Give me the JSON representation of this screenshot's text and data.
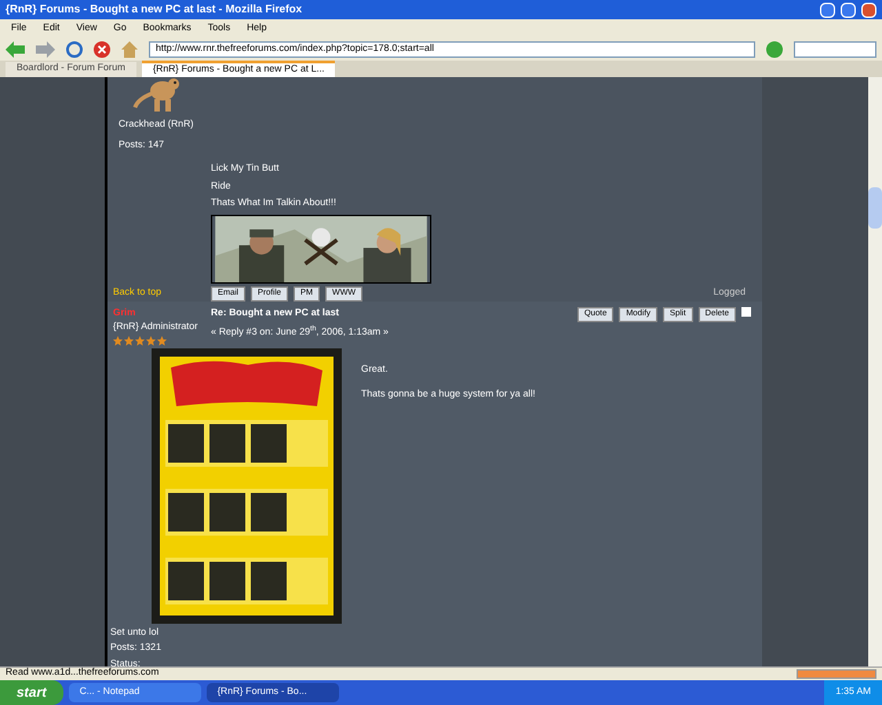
{
  "window": {
    "title": "{RnR} Forums - Bought a new PC at last - Mozilla Firefox"
  },
  "menu": [
    "File",
    "Edit",
    "View",
    "Go",
    "Bookmarks",
    "Tools",
    "Help"
  ],
  "address": {
    "url": "http://www.rnr.thefreeforums.com/index.php?topic=178.0;start=all"
  },
  "tabs": [
    {
      "label": "Boardlord - Forum Forum",
      "selected": false
    },
    {
      "label": "{RnR} Forums - Bought a new PC at L...",
      "selected": true
    }
  ],
  "previous_post": {
    "author_lines": [
      "Crackhead (RnR)",
      "Posts: 147"
    ],
    "signature": [
      "Lick My Tin Butt",
      "Ride",
      "Thats What Im Talkin About!!!"
    ],
    "back_to_top": "Back to top",
    "buttons": [
      "Email",
      "Profile",
      "PM",
      "WWW"
    ],
    "logged": "Logged"
  },
  "post": {
    "author": "Grim",
    "role": "{RnR} Administrator",
    "stars": 5,
    "title": "Re: Bought a new PC at last",
    "meta": "« Reply #3 on: June 29$^{th}$, 2006, 1:13am »",
    "actions": [
      "Quote",
      "Modify",
      "Split",
      "Delete"
    ],
    "checked": false,
    "body": [
      "Great.",
      "Thats gonna be a huge system for ya all!"
    ],
    "footer": [
      "Set unto lol",
      "Posts: 1321",
      "Status:"
    ]
  },
  "status_bar": {
    "text": "Read www.a1d...thefreeforums.com",
    "level": 1
  },
  "taskbar": {
    "start": "start",
    "items": [
      {
        "label": "C... - Notepad",
        "selected": false
      },
      {
        "label": "{RnR} Forums - Bo...",
        "selected": true
      }
    ],
    "clock": "1:35 AM"
  }
}
